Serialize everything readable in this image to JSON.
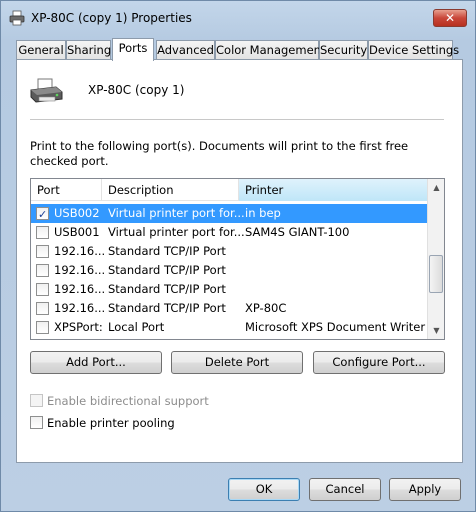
{
  "window": {
    "title": "XP-80C (copy 1) Properties",
    "close_symbol": "✕"
  },
  "tabs": [
    {
      "label": "General"
    },
    {
      "label": "Sharing"
    },
    {
      "label": "Ports"
    },
    {
      "label": "Advanced"
    },
    {
      "label": "Color Management"
    },
    {
      "label": "Security"
    },
    {
      "label": "Device Settings"
    }
  ],
  "active_tab": "Ports",
  "printer": {
    "name": "XP-80C (copy 1)"
  },
  "instruction": "Print to the following port(s). Documents will print to the first free checked port.",
  "ports_table": {
    "columns": {
      "port": "Port",
      "description": "Description",
      "printer": "Printer"
    },
    "rows": [
      {
        "checked": true,
        "selected": true,
        "port": "USB002",
        "description": "Virtual printer port for...",
        "printer": "in bep"
      },
      {
        "checked": false,
        "selected": false,
        "port": "USB001",
        "description": "Virtual printer port for...",
        "printer": "SAM4S GIANT-100"
      },
      {
        "checked": false,
        "selected": false,
        "port": "192.16...",
        "description": "Standard TCP/IP Port",
        "printer": ""
      },
      {
        "checked": false,
        "selected": false,
        "port": "192.16...",
        "description": "Standard TCP/IP Port",
        "printer": ""
      },
      {
        "checked": false,
        "selected": false,
        "port": "192.16...",
        "description": "Standard TCP/IP Port",
        "printer": ""
      },
      {
        "checked": false,
        "selected": false,
        "port": "192.16...",
        "description": "Standard TCP/IP Port",
        "printer": "XP-80C"
      },
      {
        "checked": false,
        "selected": false,
        "port": "XPSPort:",
        "description": "Local Port",
        "printer": "Microsoft XPS Document Writer"
      }
    ]
  },
  "buttons": {
    "add_port": "Add Port...",
    "delete_port": "Delete Port",
    "configure_port": "Configure Port...",
    "ok": "OK",
    "cancel": "Cancel",
    "apply": "Apply"
  },
  "options": {
    "bidirectional": {
      "label": "Enable bidirectional support",
      "checked": false,
      "enabled": false
    },
    "pooling": {
      "label": "Enable printer pooling",
      "checked": false,
      "enabled": true
    }
  },
  "colors": {
    "selection": "#3399ff",
    "close_button": "#c9473a"
  }
}
